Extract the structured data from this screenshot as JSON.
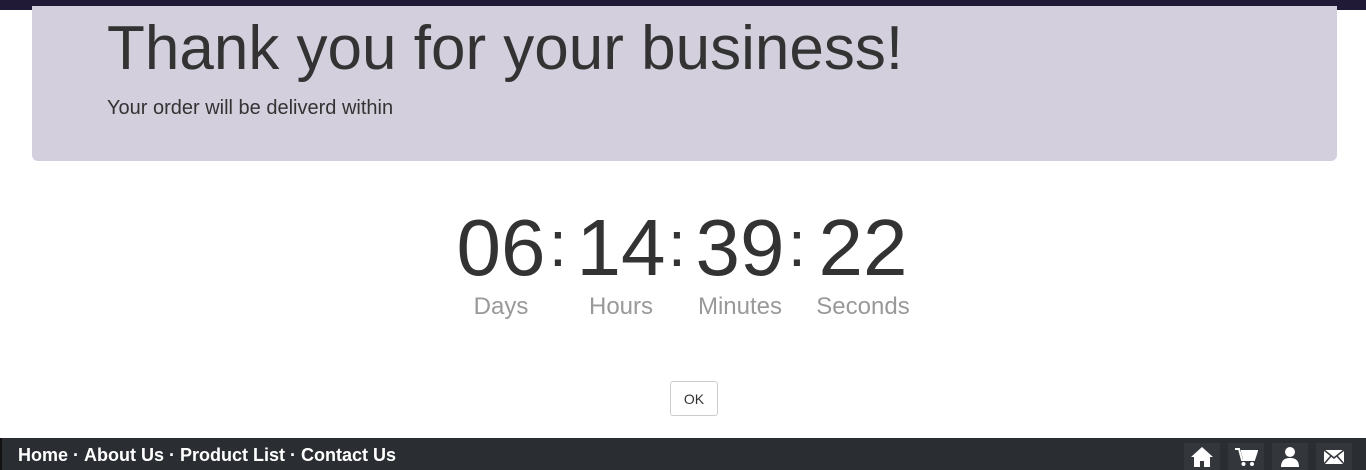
{
  "jumbotron": {
    "title": "Thank you for your business!",
    "subtitle": "Your order will be deliverd within"
  },
  "countdown": {
    "separator": ":",
    "units": [
      {
        "value": "06",
        "label": "Days"
      },
      {
        "value": "14",
        "label": "Hours"
      },
      {
        "value": "39",
        "label": "Minutes"
      },
      {
        "value": "22",
        "label": "Seconds"
      }
    ]
  },
  "ok_button": {
    "label": "OK"
  },
  "footer": {
    "links": [
      {
        "label": "Home"
      },
      {
        "label": "About Us"
      },
      {
        "label": "Product List"
      },
      {
        "label": "Contact Us"
      }
    ],
    "separator": "·",
    "icons": [
      "home-icon",
      "cart-icon",
      "user-icon",
      "mail-icon"
    ]
  },
  "colors": {
    "jumbotron_bg": "#d3cfdd",
    "top_bar": "#211a37",
    "footer_bg": "#2a2d31",
    "label_gray": "#999999"
  }
}
